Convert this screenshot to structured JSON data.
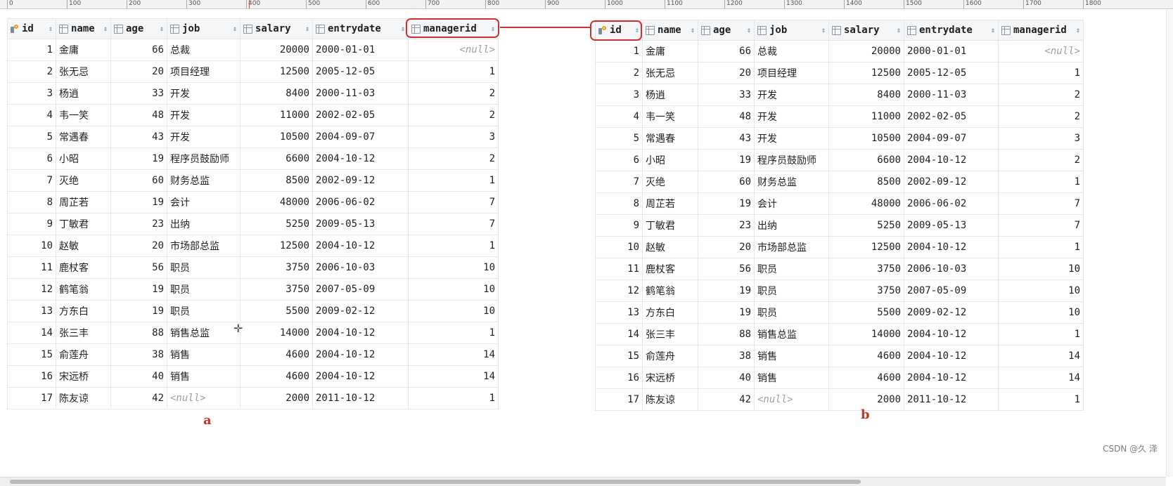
{
  "ruler": {
    "labels": [
      "0",
      "100",
      "200",
      "300",
      "400",
      "500",
      "600",
      "700",
      "800",
      "900",
      "1000",
      "1100",
      "1200",
      "1300",
      "1400",
      "1500",
      "1600",
      "1700",
      "1800"
    ]
  },
  "columns": [
    "id",
    "name",
    "age",
    "job",
    "salary",
    "entrydate",
    "managerid"
  ],
  "rows": [
    {
      "id": "1",
      "name": "金庸",
      "age": "66",
      "job": "总裁",
      "salary": "20000",
      "entrydate": "2000-01-01",
      "managerid": "<null>"
    },
    {
      "id": "2",
      "name": "张无忌",
      "age": "20",
      "job": "项目经理",
      "salary": "12500",
      "entrydate": "2005-12-05",
      "managerid": "1"
    },
    {
      "id": "3",
      "name": "杨逍",
      "age": "33",
      "job": "开发",
      "salary": "8400",
      "entrydate": "2000-11-03",
      "managerid": "2"
    },
    {
      "id": "4",
      "name": "韦一笑",
      "age": "48",
      "job": "开发",
      "salary": "11000",
      "entrydate": "2002-02-05",
      "managerid": "2"
    },
    {
      "id": "5",
      "name": "常遇春",
      "age": "43",
      "job": "开发",
      "salary": "10500",
      "entrydate": "2004-09-07",
      "managerid": "3"
    },
    {
      "id": "6",
      "name": "小昭",
      "age": "19",
      "job": "程序员鼓励师",
      "salary": "6600",
      "entrydate": "2004-10-12",
      "managerid": "2"
    },
    {
      "id": "7",
      "name": "灭绝",
      "age": "60",
      "job": "财务总监",
      "salary": "8500",
      "entrydate": "2002-09-12",
      "managerid": "1"
    },
    {
      "id": "8",
      "name": "周芷若",
      "age": "19",
      "job": "会计",
      "salary": "48000",
      "entrydate": "2006-06-02",
      "managerid": "7"
    },
    {
      "id": "9",
      "name": "丁敏君",
      "age": "23",
      "job": "出纳",
      "salary": "5250",
      "entrydate": "2009-05-13",
      "managerid": "7"
    },
    {
      "id": "10",
      "name": "赵敏",
      "age": "20",
      "job": "市场部总监",
      "salary": "12500",
      "entrydate": "2004-10-12",
      "managerid": "1"
    },
    {
      "id": "11",
      "name": "鹿杖客",
      "age": "56",
      "job": "职员",
      "salary": "3750",
      "entrydate": "2006-10-03",
      "managerid": "10"
    },
    {
      "id": "12",
      "name": "鹤笔翁",
      "age": "19",
      "job": "职员",
      "salary": "3750",
      "entrydate": "2007-05-09",
      "managerid": "10"
    },
    {
      "id": "13",
      "name": "方东白",
      "age": "19",
      "job": "职员",
      "salary": "5500",
      "entrydate": "2009-02-12",
      "managerid": "10"
    },
    {
      "id": "14",
      "name": "张三丰",
      "age": "88",
      "job": "销售总监",
      "salary": "14000",
      "entrydate": "2004-10-12",
      "managerid": "1"
    },
    {
      "id": "15",
      "name": "俞莲舟",
      "age": "38",
      "job": "销售",
      "salary": "4600",
      "entrydate": "2004-10-12",
      "managerid": "14"
    },
    {
      "id": "16",
      "name": "宋远桥",
      "age": "40",
      "job": "销售",
      "salary": "4600",
      "entrydate": "2004-10-12",
      "managerid": "14"
    },
    {
      "id": "17",
      "name": "陈友谅",
      "age": "42",
      "job": "<null>",
      "salary": "2000",
      "entrydate": "2011-10-12",
      "managerid": "1"
    }
  ],
  "labels": {
    "a": "a",
    "b": "b"
  },
  "watermark": "CSDN @久 泽",
  "accent_color": "#d23030"
}
